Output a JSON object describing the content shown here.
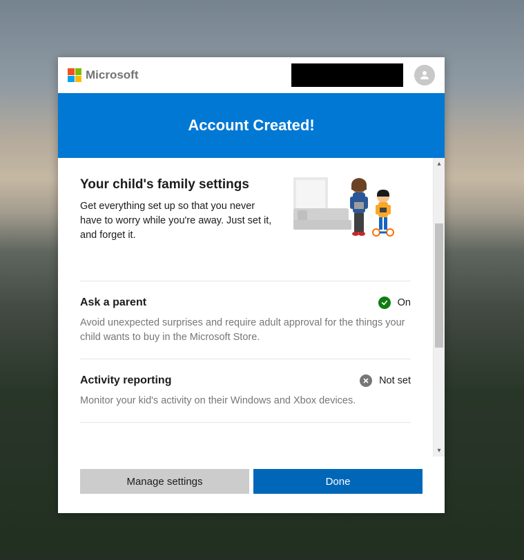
{
  "header": {
    "brand": "Microsoft"
  },
  "banner": {
    "title": "Account Created!"
  },
  "intro": {
    "heading": "Your child's family settings",
    "body": "Get everything set up so that you never have to worry while you're away. Just set it, and forget it."
  },
  "settings": [
    {
      "title": "Ask a parent",
      "description": "Avoid unexpected surprises and require adult approval for the things your child wants to buy in the Microsoft Store.",
      "status_label": "On",
      "status": "on"
    },
    {
      "title": "Activity reporting",
      "description": "Monitor your kid's activity on their Windows and Xbox devices.",
      "status_label": "Not set",
      "status": "off"
    }
  ],
  "footer": {
    "manage": "Manage settings",
    "done": "Done"
  }
}
